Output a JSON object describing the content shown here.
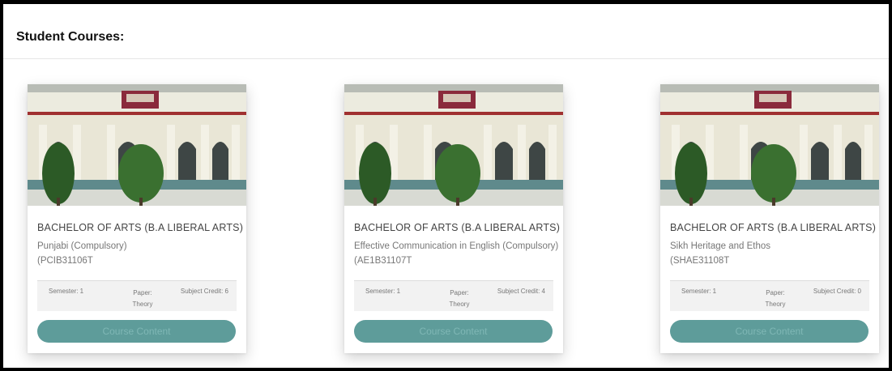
{
  "page": {
    "title": "Student Courses:"
  },
  "courses": [
    {
      "program": "BACHELOR OF ARTS (B.A LIBERAL ARTS)",
      "subject": "Punjabi (Compulsory)",
      "code": "(PCIB31106T",
      "semester_label": "Semester: 1",
      "paper_label": "Paper:",
      "paper_value": "Theory",
      "credit_label": "Subject Credit: 6",
      "button_label": "Course Content"
    },
    {
      "program": "BACHELOR OF ARTS (B.A LIBERAL ARTS)",
      "subject": "Effective Communication in English (Compulsory)",
      "code": "(AE1B31107T",
      "semester_label": "Semester: 1",
      "paper_label": "Paper:",
      "paper_value": "Theory",
      "credit_label": "Subject Credit: 4",
      "button_label": "Course Content"
    },
    {
      "program": "BACHELOR OF ARTS (B.A LIBERAL ARTS)",
      "subject": "Sikh Heritage and Ethos",
      "code": "(SHAE31108T",
      "semester_label": "Semester: 1",
      "paper_label": "Paper:",
      "paper_value": "Theory",
      "credit_label": "Subject Credit: 0",
      "button_label": "Course Content"
    }
  ],
  "colors": {
    "button_bg": "#5e9c9a",
    "button_text": "#7fb7b5",
    "sign_board": "#8a2a3c"
  }
}
